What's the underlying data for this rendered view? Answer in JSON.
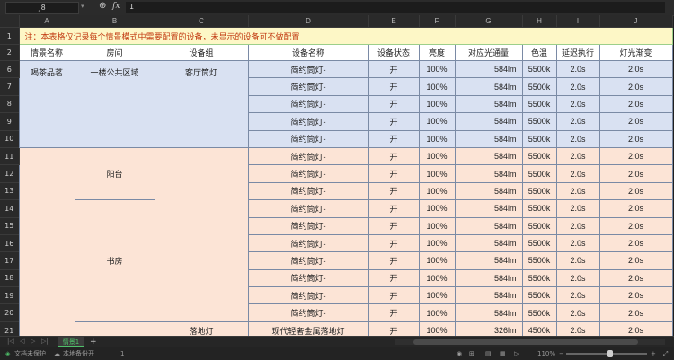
{
  "formula_bar": {
    "cell_ref": "J8",
    "fx": "fx",
    "value": "1"
  },
  "columns": [
    "A",
    "B",
    "C",
    "D",
    "E",
    "F",
    "G",
    "H",
    "I",
    "J"
  ],
  "note_row": {
    "row": "1",
    "text": "注：本表格仅记录每个情景模式中需要配置的设备，未显示的设备可不做配置"
  },
  "header_row": {
    "row": "2",
    "cells": [
      "情景名称",
      "房间",
      "设备组",
      "设备名称",
      "设备状态",
      "亮度",
      "对应光通量",
      "色温",
      "延迟执行",
      "灯光渐变"
    ]
  },
  "blocks": {
    "scene_1": "喝茶品茗",
    "room_1": "一楼公共区域",
    "group_1": "客厅筒灯",
    "room_balcony": "阳台",
    "room_study": "书房",
    "group_partial": "落地灯"
  },
  "rows": [
    {
      "row": "6",
      "device": "简约筒灯-",
      "state": "开",
      "brightness": "100%",
      "lumen": "584lm",
      "cct": "5500k",
      "delay": "2.0s",
      "fade": "2.0s"
    },
    {
      "row": "7",
      "device": "简约筒灯-",
      "state": "开",
      "brightness": "100%",
      "lumen": "584lm",
      "cct": "5500k",
      "delay": "2.0s",
      "fade": "2.0s"
    },
    {
      "row": "8",
      "device": "简约筒灯-",
      "state": "开",
      "brightness": "100%",
      "lumen": "584lm",
      "cct": "5500k",
      "delay": "2.0s",
      "fade": "2.0s"
    },
    {
      "row": "9",
      "device": "简约筒灯-",
      "state": "开",
      "brightness": "100%",
      "lumen": "584lm",
      "cct": "5500k",
      "delay": "2.0s",
      "fade": "2.0s"
    },
    {
      "row": "10",
      "device": "简约筒灯-",
      "state": "开",
      "brightness": "100%",
      "lumen": "584lm",
      "cct": "5500k",
      "delay": "2.0s",
      "fade": "2.0s"
    },
    {
      "row": "11",
      "device": "简约筒灯-",
      "state": "开",
      "brightness": "100%",
      "lumen": "584lm",
      "cct": "5500k",
      "delay": "2.0s",
      "fade": "2.0s"
    },
    {
      "row": "12",
      "device": "简约筒灯-",
      "state": "开",
      "brightness": "100%",
      "lumen": "584lm",
      "cct": "5500k",
      "delay": "2.0s",
      "fade": "2.0s"
    },
    {
      "row": "13",
      "device": "简约筒灯-",
      "state": "开",
      "brightness": "100%",
      "lumen": "584lm",
      "cct": "5500k",
      "delay": "2.0s",
      "fade": "2.0s"
    },
    {
      "row": "14",
      "device": "简约筒灯-",
      "state": "开",
      "brightness": "100%",
      "lumen": "584lm",
      "cct": "5500k",
      "delay": "2.0s",
      "fade": "2.0s"
    },
    {
      "row": "15",
      "device": "简约筒灯-",
      "state": "开",
      "brightness": "100%",
      "lumen": "584lm",
      "cct": "5500k",
      "delay": "2.0s",
      "fade": "2.0s"
    },
    {
      "row": "16",
      "device": "简约筒灯-",
      "state": "开",
      "brightness": "100%",
      "lumen": "584lm",
      "cct": "5500k",
      "delay": "2.0s",
      "fade": "2.0s"
    },
    {
      "row": "17",
      "device": "简约筒灯-",
      "state": "开",
      "brightness": "100%",
      "lumen": "584lm",
      "cct": "5500k",
      "delay": "2.0s",
      "fade": "2.0s"
    },
    {
      "row": "18",
      "device": "简约筒灯-",
      "state": "开",
      "brightness": "100%",
      "lumen": "584lm",
      "cct": "5500k",
      "delay": "2.0s",
      "fade": "2.0s"
    },
    {
      "row": "19",
      "device": "简约筒灯-",
      "state": "开",
      "brightness": "100%",
      "lumen": "584lm",
      "cct": "5500k",
      "delay": "2.0s",
      "fade": "2.0s"
    },
    {
      "row": "20",
      "device": "简约筒灯-",
      "state": "开",
      "brightness": "100%",
      "lumen": "584lm",
      "cct": "5500k",
      "delay": "2.0s",
      "fade": "2.0s"
    },
    {
      "row": "21",
      "device": "现代轻奢金属落地灯",
      "state": "开",
      "brightness": "100%",
      "lumen": "326lm",
      "cct": "4500k",
      "delay": "2.0s",
      "fade": "2.0s"
    }
  ],
  "sheet_tabs": {
    "active": "情景1",
    "add": "+"
  },
  "status_bar": {
    "protect": "文档未保护",
    "backup": "本地备份开",
    "count": "1",
    "zoom": "110%"
  },
  "colors": {
    "blue_block": "#d9e1f2",
    "peach_block": "#fce4d6",
    "note_bg": "#fdf7c6",
    "note_text": "#c23b12"
  }
}
